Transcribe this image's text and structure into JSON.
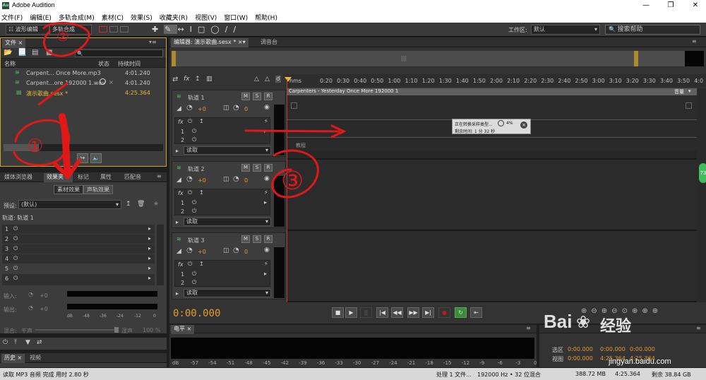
{
  "window": {
    "title": "Adobe Audition",
    "app_icon": "Au"
  },
  "menu": [
    "文件(F)",
    "编辑(E)",
    "多轨合成(M)",
    "素材(C)",
    "效果(S)",
    "收藏夹(R)",
    "视图(V)",
    "窗口(W)",
    "帮助(H)"
  ],
  "toolbar": {
    "waveform_label": "波形编辑",
    "multitrack_label": "多轨合成",
    "workspace_label": "工作区:",
    "workspace_value": "默认",
    "search_placeholder": "搜索帮助"
  },
  "files_panel": {
    "tab": "文件",
    "columns": {
      "name": "名称",
      "state": "状态",
      "duration": "持续时间"
    },
    "items": [
      {
        "name": "Carpent... Once More.mp3",
        "state": "",
        "duration": "4:01.240"
      },
      {
        "name": "Carpent...ore 192000 1.wav",
        "state": "",
        "duration": "4:01.240"
      },
      {
        "name": "演示歌曲.sesx *",
        "state": "",
        "duration": "4:25.364"
      }
    ]
  },
  "effects_panel": {
    "tabs": [
      "媒体浏览器",
      "效果夹",
      "标记",
      "属性",
      "匹配音"
    ],
    "subtabs": [
      "素材效果",
      "声轨效果"
    ],
    "preset_label": "预设:",
    "preset_value": "(默认)",
    "track_label": "轨道: 轨道 1",
    "slots": [
      "1",
      "2",
      "3",
      "4",
      "5",
      "6"
    ],
    "input_label": "输入:",
    "output_label": "输出:",
    "gain_value": "+0",
    "meter_ticks": [
      "dB",
      "-48",
      "-36",
      "-24",
      "-12",
      "0"
    ],
    "mix_label": "混合:",
    "dry_label": "干声",
    "wet_label": "湿声",
    "wet_value": "100 %"
  },
  "history_panel": {
    "tabs": [
      "历史",
      "视频"
    ]
  },
  "editor": {
    "tabs": [
      "编辑器: 演示歌曲.sesx *",
      "调音台"
    ],
    "ruler_unit": "hms",
    "ruler": [
      "0:20",
      "0:30",
      "0:40",
      "0:50",
      "1:00",
      "1:10",
      "1:20",
      "1:30",
      "1:40",
      "1:50",
      "2:00",
      "2:10",
      "2:20",
      "2:30",
      "2:40",
      "2:50",
      "3:00",
      "3:10",
      "3:20",
      "3:30",
      "3:40",
      "3:50",
      "4:0"
    ],
    "tracks": [
      {
        "name": "轨道 1",
        "volume": "+0",
        "pan": "0",
        "mode": "读取",
        "sends": [
          "1",
          "2"
        ]
      },
      {
        "name": "轨道 2",
        "volume": "+0",
        "pan": "0",
        "mode": "读取",
        "sends": [
          "1",
          "2"
        ]
      },
      {
        "name": "轨道 3",
        "volume": "+0",
        "pan": "0",
        "mode": "读取",
        "sends": [
          "1",
          "2"
        ]
      }
    ],
    "clip_title": "Carpenters - Yesterday Once More 192000 1",
    "clip_tag": "音量",
    "clip_marker": "教程",
    "progress": {
      "line1": "正在转换采样类型...",
      "percent": "4%",
      "line2": "剩余时间: 1 分 32 秒"
    },
    "timecode": "0:00.000",
    "side_badge": "73"
  },
  "level_panel": {
    "tab": "电平",
    "ticks": [
      "dB",
      "-57",
      "-54",
      "-51",
      "-48",
      "-45",
      "-42",
      "-39",
      "-36",
      "-33",
      "-30",
      "-27",
      "-24",
      "-21",
      "-18",
      "-15",
      "-12",
      "-9",
      "-6",
      "-3",
      "0"
    ]
  },
  "selection_panel": {
    "select_label": "选区",
    "view_label": "视图",
    "value": "0:00.000",
    "end_value": "4:25.364"
  },
  "status": {
    "left": "读取 MP3 音频 完成 用时 2.80 秒",
    "processing": "处理 1 文件...",
    "format": "192000 Hz • 32 位混合",
    "size": "388.72 MB",
    "duration": "4:25.364",
    "free": "剩余 38.84 GB"
  },
  "watermark": {
    "brand": "Bai",
    "brand_suffix": "经验",
    "url": "jingyan.baidu.com"
  },
  "annotations": [
    "①",
    "②",
    "③"
  ],
  "colors": {
    "accent_green": "#4fc36a",
    "timecode_orange": "#e89a2a",
    "playhead_red": "#d03030",
    "annotation_red": "#e01818"
  }
}
